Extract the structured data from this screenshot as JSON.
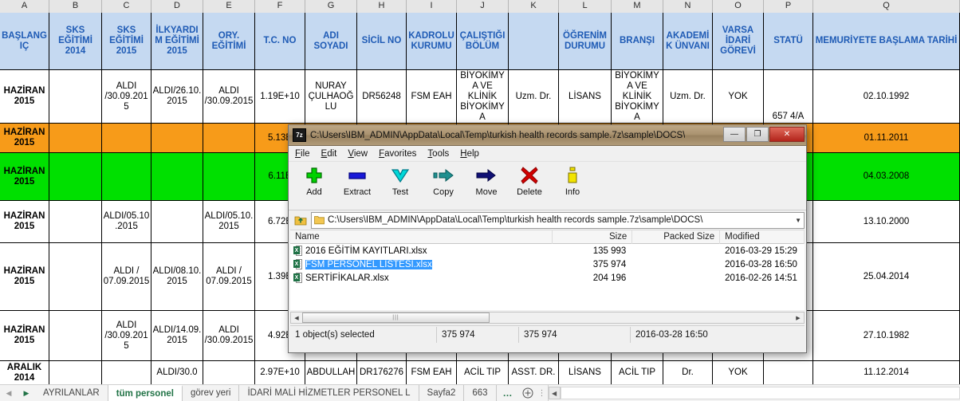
{
  "spreadsheet": {
    "column_letters": [
      "A",
      "B",
      "C",
      "D",
      "E",
      "F",
      "G",
      "H",
      "I",
      "J",
      "K",
      "L",
      "M",
      "N",
      "O",
      "P",
      "Q"
    ],
    "headers": {
      "A": "BAŞLANGIÇ",
      "B": "SKS EĞİTİMİ 2014",
      "C": "SKS EĞİTİMİ 2015",
      "D": "İLKYARDIM EĞİTİMİ 2015",
      "E": "ORY. EĞİTİMİ",
      "F": "T.C. NO",
      "G": "ADI SOYADI",
      "H": "SİCİL NO",
      "I": "KADROLU KURUMU",
      "J": "ÇALIŞTIĞI BÖLÜM",
      "K": "",
      "L": "ÖĞRENİM DURUMU",
      "M": "BRANŞI",
      "N": "AKADEMİK ÜNVANI",
      "O": "VARSA İDARİ GÖREVİ",
      "P": "STATÜ",
      "Q": "MEMURİYETE BAŞLAMA TARİHİ"
    },
    "rows": [
      {
        "fill": "white",
        "A": "HAZİRAN 2015",
        "B": "",
        "C": "ALDI /30.09.2015",
        "D": "ALDI/26.10.2015",
        "E": "ALDI /30.09.2015",
        "F": "1.19E+10",
        "G": "NURAY ÇULHAOĞLU",
        "H": "DR56248",
        "I": "FSM EAH",
        "J": "BİYOKİMYA VE KLİNİK BİYOKİMYA",
        "K": "Uzm. Dr.",
        "L": "LİSANS",
        "M": "BİYOKİMYA VE KLİNİK BİYOKİMYA",
        "N": "Uzm. Dr.",
        "O": "YOK",
        "P": "657 4/A",
        "Q": "02.10.1992"
      },
      {
        "fill": "orange",
        "A": "HAZİRAN 2015",
        "B": "",
        "C": "",
        "D": "",
        "E": "",
        "F": "5.13E",
        "G": "",
        "H": "",
        "I": "",
        "J": "",
        "K": "",
        "L": "",
        "M": "",
        "N": "",
        "O": "",
        "P": "",
        "Q": "01.11.2011"
      },
      {
        "fill": "green",
        "A": "HAZİRAN 2015",
        "B": "",
        "C": "",
        "D": "",
        "E": "",
        "F": "6.11E",
        "G": "",
        "H": "",
        "I": "",
        "J": "",
        "K": "",
        "L": "",
        "M": "",
        "N": "",
        "O": "",
        "P": "",
        "Q": "04.03.2008"
      },
      {
        "fill": "white",
        "A": "HAZİRAN 2015",
        "B": "",
        "C": "ALDI/05.10.2015",
        "D": "",
        "E": "ALDI/05.10.2015",
        "F": "6.72E",
        "G": "",
        "H": "",
        "I": "",
        "J": "",
        "K": "",
        "L": "",
        "M": "",
        "N": "",
        "O": "",
        "P": "",
        "Q": "13.10.2000"
      },
      {
        "fill": "white",
        "A": "HAZİRAN 2015",
        "B": "",
        "C": "ALDI / 07.09.2015",
        "D": "ALDI/08.10.2015",
        "E": "ALDI / 07.09.2015",
        "F": "1.39E",
        "G": "",
        "H": "",
        "I": "",
        "J": "",
        "K": "",
        "L": "",
        "M": "",
        "N": "",
        "O": "",
        "P": "",
        "Q": "25.04.2014"
      },
      {
        "fill": "white",
        "A": "HAZİRAN 2015",
        "B": "",
        "C": "ALDI /30.09.2015",
        "D": "ALDI/14.09.2015",
        "E": "ALDI /30.09.2015",
        "F": "4.92E",
        "G": "",
        "H": "",
        "I": "",
        "J": "",
        "K": "",
        "L": "",
        "M": "",
        "N": "",
        "O": "",
        "P": "",
        "Q": "27.10.1982"
      },
      {
        "fill": "white",
        "A": "ARALIK 2014",
        "B": "",
        "C": "",
        "D": "ALDI/30.0",
        "E": "",
        "F": "2.97E+10",
        "G": "ABDULLAH",
        "H": "DR176276",
        "I": "FSM EAH",
        "J": "ACİL TIP",
        "K": "ASST. DR.",
        "L": "LİSANS",
        "M": "ACİL TIP",
        "N": "Dr.",
        "O": "YOK",
        "P": "",
        "Q": "11.12.2014"
      }
    ]
  },
  "sheet_tabs": {
    "prev_label": "◀",
    "next_label": "▶",
    "tabs": [
      {
        "label": "AYRILANLAR",
        "active": false
      },
      {
        "label": "tüm personel",
        "active": true
      },
      {
        "label": "görev yeri",
        "active": false
      },
      {
        "label": "İDARİ MALİ HİZMETLER PERSONEL L",
        "active": false
      },
      {
        "label": "Sayfa2",
        "active": false
      },
      {
        "label": "663",
        "active": false
      }
    ],
    "overflow_label": "…",
    "add_sheet_label": "+",
    "scroll_left_label": "◀"
  },
  "sevenzip": {
    "title": "C:\\Users\\IBM_ADMIN\\AppData\\Local\\Temp\\turkish health records sample.7z\\sample\\DOCS\\",
    "app_icon_label": "7z",
    "window_buttons": {
      "minimize": "—",
      "maximize": "❐",
      "close": "✕"
    },
    "menu": [
      "File",
      "Edit",
      "View",
      "Favorites",
      "Tools",
      "Help"
    ],
    "toolbar": [
      {
        "label": "Add",
        "icon": "plus-icon",
        "color": "#00cc00"
      },
      {
        "label": "Extract",
        "icon": "minus-icon",
        "color": "#0000cc"
      },
      {
        "label": "Test",
        "icon": "chevron-down-icon",
        "color": "#00cccc"
      },
      {
        "label": "Copy",
        "icon": "copy-arrow-icon",
        "color": "#008080"
      },
      {
        "label": "Move",
        "icon": "move-arrow-icon",
        "color": "#000080"
      },
      {
        "label": "Delete",
        "icon": "cross-icon",
        "color": "#cc0000"
      },
      {
        "label": "Info",
        "icon": "info-icon",
        "color": "#e0e000"
      }
    ],
    "address": "C:\\Users\\IBM_ADMIN\\AppData\\Local\\Temp\\turkish health records sample.7z\\sample\\DOCS\\",
    "columns": [
      "Name",
      "Size",
      "Packed Size",
      "Modified"
    ],
    "files": [
      {
        "name": "2016 EĞİTİM KAYITLARI.xlsx",
        "size": "135 993",
        "packed": "",
        "modified": "2016-03-29 15:29",
        "selected": false
      },
      {
        "name": "FSM PERSONEL LİSTESİ.xlsx",
        "size": "375 974",
        "packed": "",
        "modified": "2016-03-28 16:50",
        "selected": true
      },
      {
        "name": "SERTİFİKALAR.xlsx",
        "size": "204 196",
        "packed": "",
        "modified": "2016-02-26 14:51",
        "selected": false
      }
    ],
    "status": {
      "selection": "1 object(s) selected",
      "size": "375 974",
      "packed_size": "375 974",
      "modified": "2016-03-28 16:50"
    }
  },
  "colors": {
    "header_fill": "#c5d9f1",
    "header_text": "#1f5bb5",
    "row_orange": "#f79b19",
    "row_green": "#00e000",
    "selection_blue": "#3399ff",
    "excel_green": "#217346"
  }
}
